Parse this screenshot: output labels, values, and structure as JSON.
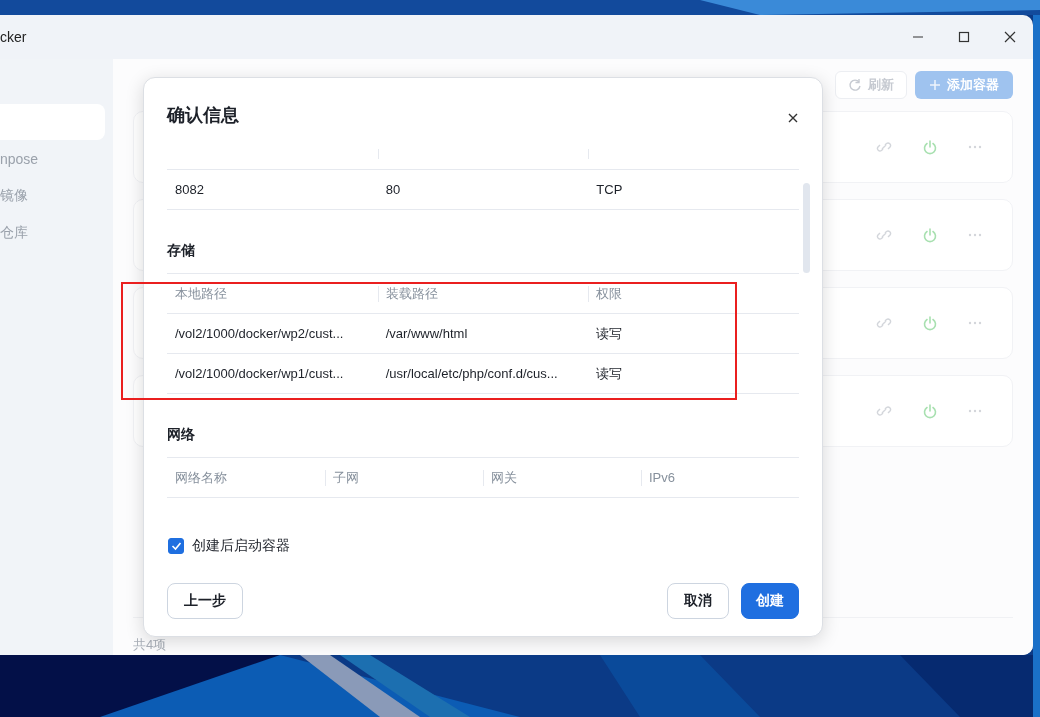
{
  "window": {
    "title": "cker"
  },
  "sidebar": {
    "items": [
      {
        "selected": true
      },
      {
        "label": "npose",
        "selected": false
      },
      {
        "label": "镜像",
        "selected": false
      },
      {
        "label": "仓库",
        "selected": false
      }
    ]
  },
  "main": {
    "refresh_button": "刷新",
    "add_button": "添加容器",
    "containers": [
      {
        "running": true
      },
      {
        "running": true
      },
      {
        "running": true
      },
      {
        "running": true
      }
    ],
    "footer": "共4项"
  },
  "dialog": {
    "title": "确认信息",
    "sections": [
      {
        "kind": "ports",
        "rows": [
          [
            "8082",
            "80",
            "TCP"
          ]
        ]
      },
      {
        "kind": "table",
        "title": "存储",
        "columns": [
          "本地路径",
          "装载路径",
          "权限"
        ],
        "rows": [
          [
            "/vol2/1000/docker/wp2/cust...",
            "/var/www/html",
            "读写"
          ],
          [
            "/vol2/1000/docker/wp1/cust...",
            "/usr/local/etc/php/conf.d/cus...",
            "读写"
          ]
        ]
      },
      {
        "kind": "table",
        "title": "网络",
        "columns": [
          "网络名称",
          "子网",
          "网关",
          "IPv6"
        ]
      }
    ],
    "checkbox": {
      "label": "创建后启动容器",
      "checked": true
    },
    "buttons": [
      {
        "kind": "secondary",
        "label": "上一步"
      },
      {
        "kind": "spacer"
      },
      {
        "kind": "secondary",
        "label": "取消"
      },
      {
        "kind": "primary",
        "label": "创建"
      }
    ]
  }
}
